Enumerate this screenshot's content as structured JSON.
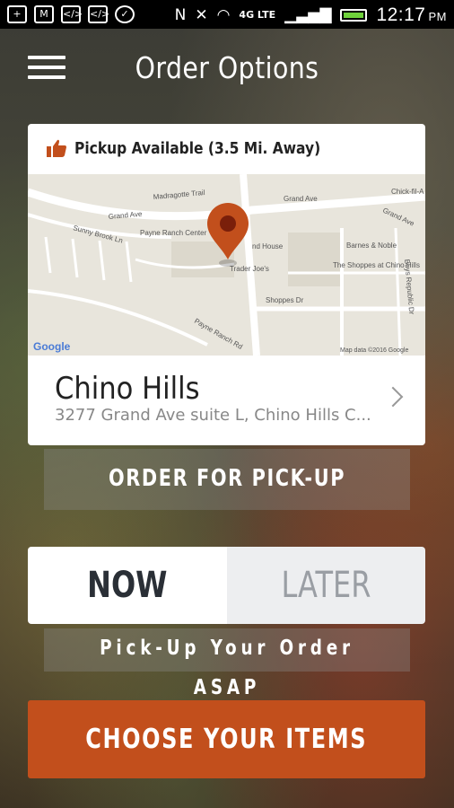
{
  "status_bar": {
    "time": "12:17",
    "ampm": "PM",
    "network": "4G LTE",
    "left_icons": [
      "plus-icon",
      "gmail-icon",
      "code-icon",
      "code-icon",
      "chat-icon",
      "nfc-icon",
      "mute-icon"
    ],
    "right_icons": [
      "wifi-icon",
      "signal-icon",
      "battery-icon"
    ]
  },
  "header": {
    "title": "Order Options",
    "menu_icon": "hamburger-icon"
  },
  "location_card": {
    "pickup_label": "Pickup Available (3.5 Mi. Away)",
    "pickup_icon": "thumbs-up-icon",
    "map": {
      "labels": [
        "Grand Ave",
        "Grand Ave",
        "Grand Ave",
        "Sunny Brook Ln",
        "Payne Ranch Center",
        "Madragotte Trail",
        "Trader Joe's",
        "Barnes & Noble",
        "The Shoppes at Chino Hills",
        "Shoppes Dr",
        "Payne Ranch Rd",
        "Boys Republic Dr",
        "Chick-fil-A",
        "nd House"
      ],
      "google_logo": "Google",
      "attribution": "Map data ©2016 Google",
      "pin_color": "#c24f1c"
    },
    "store_name": "Chino Hills",
    "store_address": "3277 Grand Ave suite L, Chino Hills C...",
    "chevron_icon": "chevron-right-icon"
  },
  "order_mode_button": "ORDER FOR PICK-UP",
  "time_toggle": {
    "options": [
      "NOW",
      "LATER"
    ],
    "selected": "NOW"
  },
  "time_caption": "Pick-Up Your Order ASAP",
  "primary_button": "CHOOSE YOUR ITEMS",
  "colors": {
    "accent": "#c24f1c",
    "now_text": "#2a2f36",
    "later_bg": "#edeef0"
  }
}
